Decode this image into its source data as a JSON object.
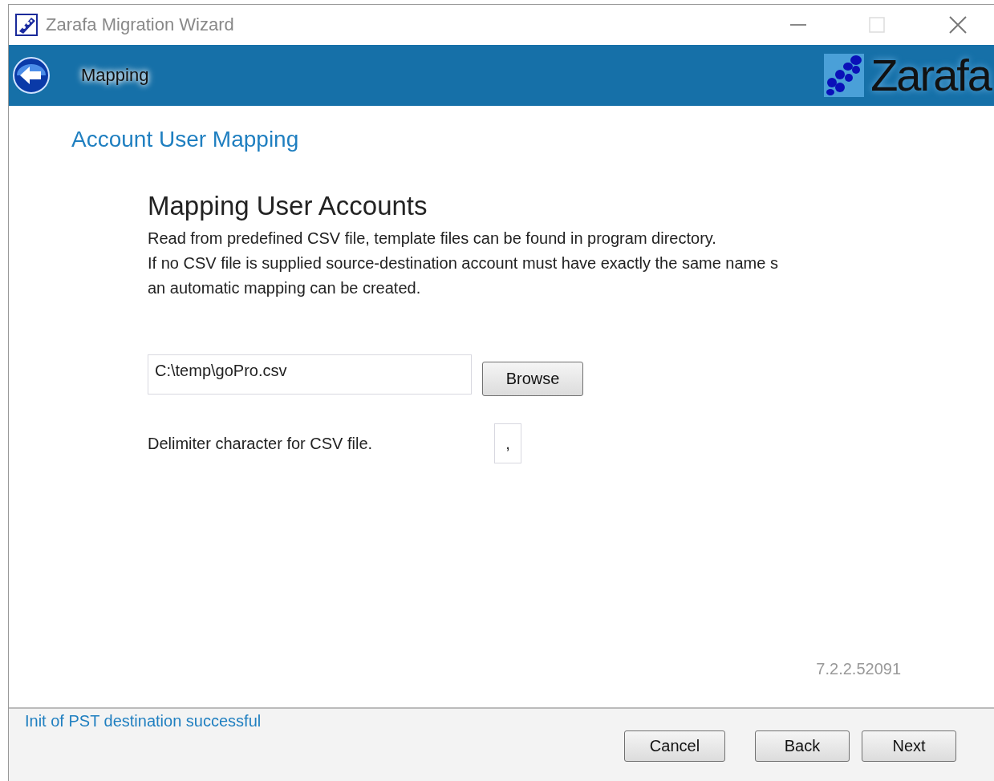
{
  "window": {
    "title": "Zarafa Migration Wizard",
    "maximize_disabled": true
  },
  "header": {
    "step": "Mapping",
    "logo_text": "Zarafa"
  },
  "page": {
    "section_title": "Account User Mapping",
    "heading": "Mapping User Accounts",
    "description": [
      "Read from predefined CSV file, template files can be found in program directory.",
      "If no CSV file is supplied source-destination account must have exactly the same name s",
      "an automatic mapping can be created."
    ],
    "file_field": {
      "value": "C:\\temp\\goPro.csv"
    },
    "browse_button": "Browse",
    "delimiter": {
      "label": "Delimiter character for CSV file.",
      "value": ","
    },
    "version": "7.2.2.52091"
  },
  "status_bar": {
    "message": "Init of PST destination successful"
  },
  "buttons": [
    "Cancel",
    "Back",
    "Next"
  ]
}
